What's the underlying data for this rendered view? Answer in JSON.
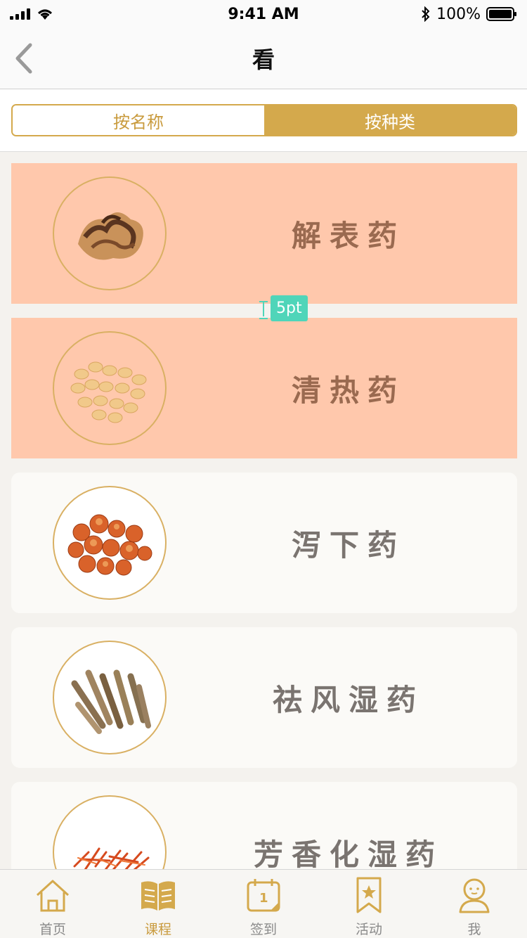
{
  "status_bar": {
    "time": "9:41 AM",
    "battery": "100%"
  },
  "nav": {
    "title": "看"
  },
  "segment": {
    "options": [
      "按名称",
      "按种类"
    ],
    "selected": "按种类"
  },
  "categories": [
    {
      "label": "解表药",
      "highlighted": true
    },
    {
      "label": "清热药",
      "highlighted": true
    },
    {
      "label": "泻下药",
      "highlighted": false
    },
    {
      "label": "祛风湿药",
      "highlighted": false
    },
    {
      "label": "芳香化湿药",
      "highlighted": false
    }
  ],
  "annotation": {
    "spacing": "5pt"
  },
  "tabs": [
    {
      "label": "首页",
      "icon": "home-icon",
      "active": false
    },
    {
      "label": "课程",
      "icon": "book-icon",
      "active": true
    },
    {
      "label": "签到",
      "icon": "calendar-icon",
      "active": false
    },
    {
      "label": "活动",
      "icon": "bookmark-star-icon",
      "active": false
    },
    {
      "label": "我",
      "icon": "person-icon",
      "active": false
    }
  ],
  "colors": {
    "accent": "#d4a94c",
    "highlight": "#ffc8ac",
    "measure": "#4fd5b9"
  }
}
